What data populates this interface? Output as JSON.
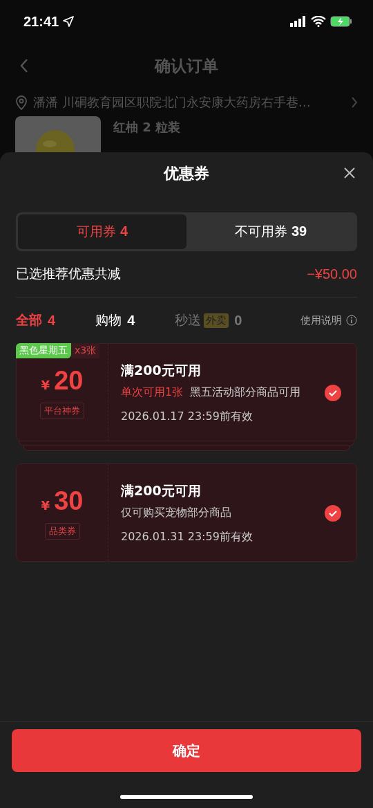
{
  "status_bar": {
    "time": "21:41"
  },
  "page": {
    "title": "确认订单",
    "address_name": "潘潘",
    "address": "川硐教育园区职院北门永安康大药房右手巷…",
    "product": "红柚 2 粒装"
  },
  "sheet": {
    "title": "优惠券",
    "segments": [
      {
        "label": "可用券",
        "count": "4",
        "selected": true
      },
      {
        "label": "不可用券",
        "count": "39",
        "selected": false
      }
    ],
    "summary": {
      "label": "已选推荐优惠共减",
      "amount": "−¥50.00"
    },
    "filters": [
      {
        "label": "全部",
        "count": "4",
        "selected": true,
        "disabled": false
      },
      {
        "label": "购物",
        "count": "4",
        "selected": false,
        "disabled": false
      },
      {
        "label": "秒送",
        "badge": "外卖",
        "count": "0",
        "selected": false,
        "disabled": true
      }
    ],
    "help": "使用说明",
    "coupons": [
      {
        "tag": "黑色星期五",
        "multiplier": "x3张",
        "currency": "¥",
        "amount": "20",
        "type": "平台神券",
        "title": "满200元可用",
        "limit": "单次可用1张",
        "note": "黑五活动部分商品可用",
        "expiry": "2026.01.17 23:59前有效",
        "checked": true,
        "stacked": true
      },
      {
        "currency": "¥",
        "amount": "30",
        "type": "品类券",
        "title": "满200元可用",
        "note": "仅可购买宠物部分商品",
        "expiry": "2026.01.31 23:59前有效",
        "checked": true,
        "stacked": false
      }
    ],
    "confirm": "确定"
  }
}
